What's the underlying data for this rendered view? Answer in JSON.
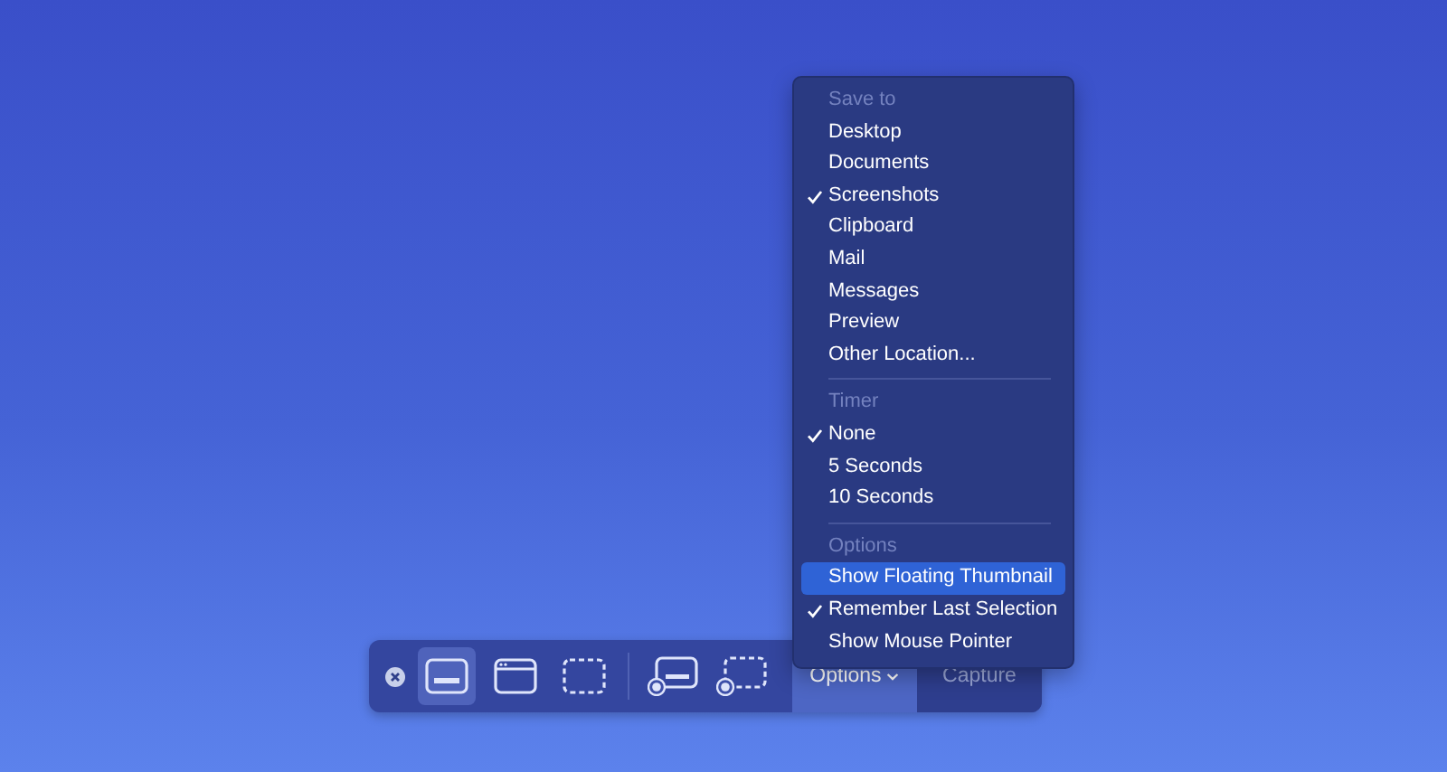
{
  "toolbar": {
    "tools": [
      {
        "kind": "screen",
        "selected": true
      },
      {
        "kind": "window",
        "selected": false
      },
      {
        "kind": "selection",
        "selected": false
      },
      {
        "kind": "record-screen",
        "selected": false
      },
      {
        "kind": "record-selection",
        "selected": false
      }
    ],
    "options_button": {
      "label": "Options",
      "open": true
    },
    "capture_button": {
      "label": "Capture",
      "disabled": true
    }
  },
  "menu": {
    "sections": [
      {
        "heading": "Save to",
        "items": [
          {
            "label": "Desktop",
            "checked": false,
            "selected": false
          },
          {
            "label": "Documents",
            "checked": false,
            "selected": false
          },
          {
            "label": "Screenshots",
            "checked": true,
            "selected": false
          },
          {
            "label": "Clipboard",
            "checked": false,
            "selected": false
          },
          {
            "label": "Mail",
            "checked": false,
            "selected": false
          },
          {
            "label": "Messages",
            "checked": false,
            "selected": false
          },
          {
            "label": "Preview",
            "checked": false,
            "selected": false
          },
          {
            "label": "Other Location...",
            "checked": false,
            "selected": false
          }
        ]
      },
      {
        "heading": "Timer",
        "items": [
          {
            "label": "None",
            "checked": true,
            "selected": false
          },
          {
            "label": "5 Seconds",
            "checked": false,
            "selected": false
          },
          {
            "label": "10 Seconds",
            "checked": false,
            "selected": false
          }
        ]
      },
      {
        "heading": "Options",
        "items": [
          {
            "label": "Show Floating Thumbnail",
            "checked": false,
            "selected": true
          },
          {
            "label": "Remember Last Selection",
            "checked": true,
            "selected": false
          },
          {
            "label": "Show Mouse Pointer",
            "checked": false,
            "selected": false
          }
        ]
      }
    ]
  }
}
